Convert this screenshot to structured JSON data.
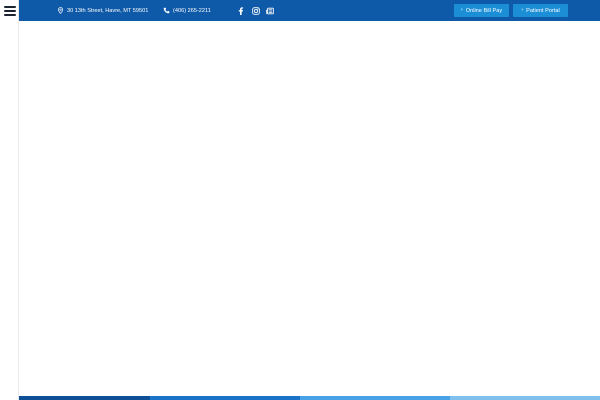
{
  "topbar": {
    "address": "30 13th Street, Havre, MT 59501",
    "phone": "(406) 265-2211",
    "social": [
      {
        "icon": "facebook-icon"
      },
      {
        "icon": "instagram-icon"
      },
      {
        "icon": "newsletter-icon"
      }
    ],
    "buttons": {
      "bill_pay": "Online Bill Pay",
      "patient_portal": "Patient Portal",
      "chevron": "›"
    }
  },
  "sidebar": {
    "menu_icon": "hamburger-menu-icon"
  },
  "colors": {
    "topbar_bg": "#0f5aa8",
    "button_bg": "#1c8ed6",
    "bottom_bar": [
      "#0e4f95",
      "#1a73c9",
      "#4aa2e6",
      "#7fc0ee"
    ]
  }
}
